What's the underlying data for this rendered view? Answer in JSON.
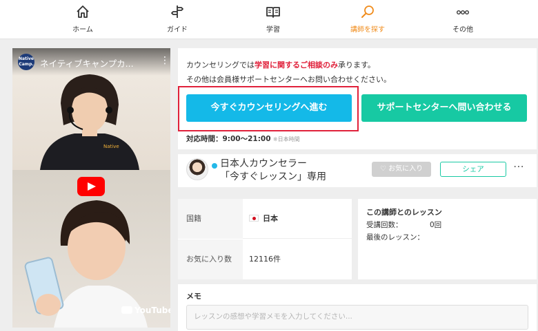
{
  "nav": {
    "items": [
      {
        "label": "ホーム",
        "icon": "home-icon"
      },
      {
        "label": "ガイド",
        "icon": "signpost-icon"
      },
      {
        "label": "学習",
        "icon": "book-icon"
      },
      {
        "label": "講師を探す",
        "icon": "search-icon",
        "active": true
      },
      {
        "label": "その他",
        "icon": "more-icon"
      }
    ],
    "active_color": "#f08c1c"
  },
  "video": {
    "title": "ネイティブキャンプカ...",
    "channel_logo": "Native Camp.",
    "brand": "YouTube"
  },
  "counseling": {
    "line1_pre": "カウンセリングでは",
    "line1_emph": "学習に関するご相談のみ",
    "line1_post": "承ります。",
    "line2": "その他は会員様サポートセンターへお問い合わせください。",
    "primary_button": "今すぐカウンセリングへ進む",
    "secondary_button": "サポートセンターへ問い合わせる",
    "hours_label": "対応時間：9:00〜21:00",
    "hours_note": "※日本時間",
    "colors": {
      "primary": "#14b9e8",
      "secondary": "#17c9a3",
      "emphasis": "#e0203a"
    }
  },
  "teacher": {
    "name_line1": "日本人カウンセラー",
    "name_line2": "「今すぐレッスン」専用",
    "favorite_button": "お気に入り",
    "share_button": "シェア",
    "more_button": "⋯"
  },
  "info": {
    "nationality_label": "国籍",
    "nationality_value": "日本",
    "favorites_label": "お気に入り数",
    "favorites_value": "12116件"
  },
  "lessons": {
    "title": "この講師とのレッスン",
    "count_label": "受講回数：",
    "count_value": "0回",
    "last_label": "最後のレッスン："
  },
  "memo": {
    "title": "メモ",
    "placeholder": "レッスンの感想や学習メモを入力してください..."
  }
}
